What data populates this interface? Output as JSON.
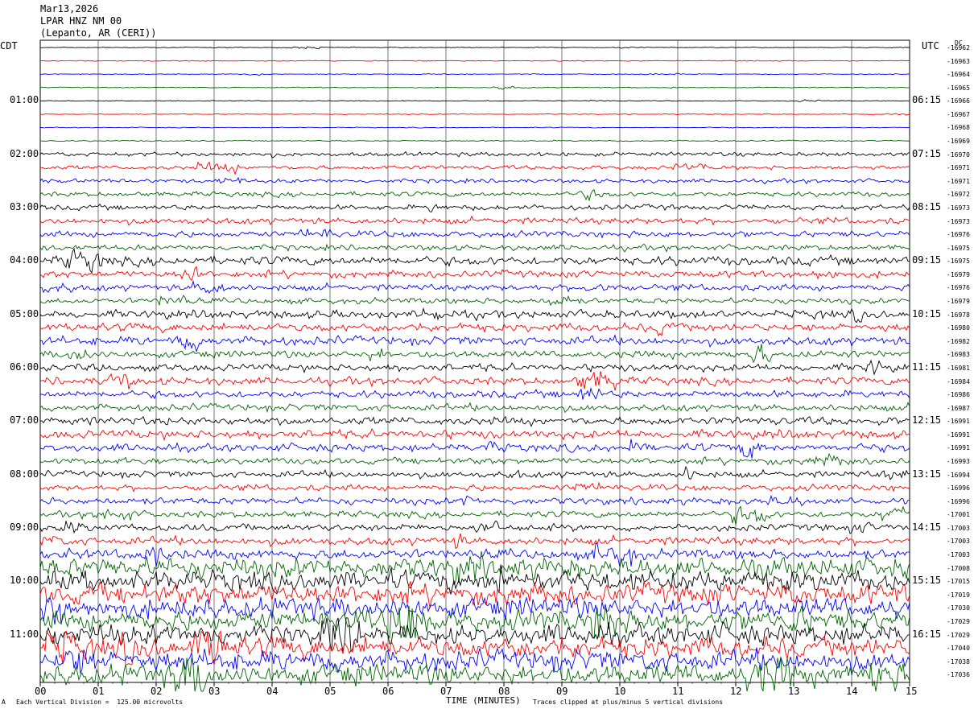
{
  "header": {
    "date": "Mar13,2026",
    "station": "LPAR HNZ NM 00",
    "location": "(Lepanto, AR (CERI))"
  },
  "left_axis_title": "CDT",
  "right_axis_title": "UTC",
  "dc_header": "DC",
  "footer": {
    "scale_note": "Each Vertical Division =  125.00 microvolts",
    "clip_note": "Traces clipped at plus/minus 5 vertical divisions",
    "corner_mark": "A"
  },
  "colors": {
    "trace_cycle": [
      "#000000",
      "#ff0000",
      "#0000ff",
      "#006400"
    ],
    "grid": "#000000"
  },
  "chart_data": {
    "type": "line",
    "title": "LPAR HNZ NM 00",
    "xlabel": "TIME (MINUTES)",
    "x_ticks": [
      "00",
      "01",
      "02",
      "03",
      "04",
      "05",
      "06",
      "07",
      "08",
      "09",
      "10",
      "11",
      "12",
      "13",
      "14",
      "15"
    ],
    "xlim": [
      0,
      15
    ],
    "left_time_labels": [
      "01:00",
      "02:00",
      "03:00",
      "04:00",
      "05:00",
      "06:00",
      "07:00",
      "08:00",
      "09:00",
      "10:00",
      "11:00"
    ],
    "right_time_labels": [
      "06:15",
      "07:15",
      "08:15",
      "09:15",
      "10:15",
      "11:15",
      "12:15",
      "13:15",
      "14:15",
      "15:15",
      "16:15"
    ],
    "hour_label_every_n_traces": 4,
    "hour_label_first_trace": 4,
    "dc_offsets": [
      "-16962",
      "-16963",
      "-16964",
      "-16965",
      "-16966",
      "-16967",
      "-16968",
      "-16969",
      "-16970",
      "-16971",
      "-16971",
      "-16972",
      "-16973",
      "-16973",
      "-16976",
      "-16975",
      "-16975",
      "-16979",
      "-16976",
      "-16979",
      "-16978",
      "-16980",
      "-16982",
      "-16983",
      "-16981",
      "-16984",
      "-16986",
      "-16987",
      "-16991",
      "-16991",
      "-16991",
      "-16993",
      "-16994",
      "-16996",
      "-16996",
      "-17001",
      "-17003",
      "-17003",
      "-17003",
      "-17008",
      "-17015",
      "-17019",
      "-17030",
      "-17029",
      "-17029",
      "-17040",
      "-17038",
      "-17036"
    ],
    "trace_amplitude_levels": [
      0.2,
      0.2,
      0.2,
      0.2,
      0.2,
      0.2,
      0.2,
      0.3,
      1,
      1,
      1,
      1.2,
      1.3,
      1.6,
      1.5,
      1.4,
      2.2,
      1.7,
      1.6,
      1.4,
      2,
      2,
      2.1,
      1.7,
      1.8,
      1.9,
      1.8,
      1.7,
      2,
      2.1,
      1.9,
      1.6,
      1.6,
      1.5,
      1.7,
      1.6,
      1.7,
      2,
      2.4,
      5,
      5,
      5,
      5,
      5,
      5,
      5,
      5,
      5
    ],
    "amplitude_unit": "vertical divisions",
    "clip_limit": 5,
    "grid": true
  }
}
